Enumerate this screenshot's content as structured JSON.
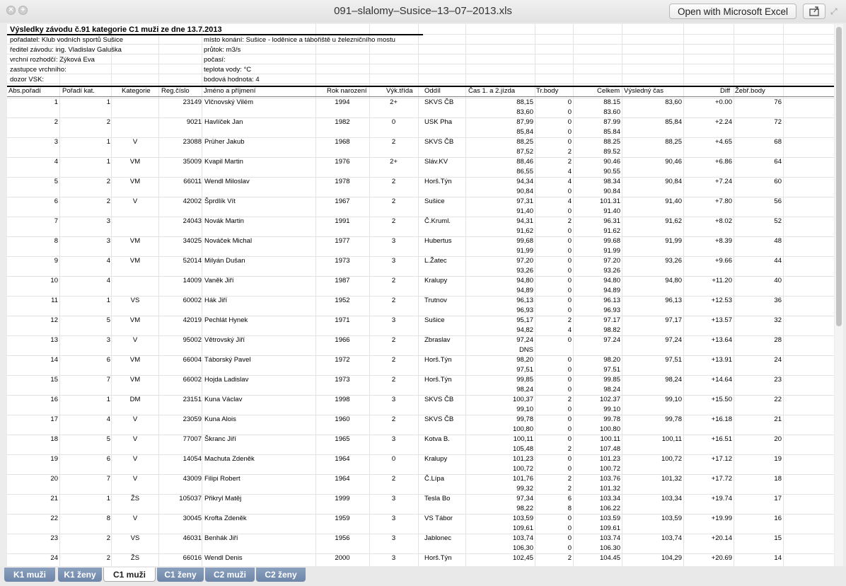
{
  "window": {
    "title": "091–slalomy–Susice–13–07–2013.xls",
    "open_button": "Open with Microsoft Excel",
    "close_icon": "close-icon",
    "zoom_icon": "zoom-plus-icon",
    "share_icon": "share-icon",
    "expand_icon": "expand-icon"
  },
  "info": {
    "title": "Výsledky závodu č.91 kategorie C1 muži ze dne 13.7.2013",
    "left": [
      "pořadatel: Klub vodních sportů Sušice",
      "ředitel závodu: ing. Vladislav Galuška",
      "vrchní rozhodčí: Zýková Eva",
      "zastupce vrchního:",
      "dozor VSK:"
    ],
    "right": [
      "místo konání: Sušice - loděnice a tábořiště u železničního mostu",
      "průtok:  m3/s",
      "počasí:",
      "teplota vody: °C",
      "bodová hodnota: 4"
    ]
  },
  "columns": [
    "Abs.pořadí",
    "Pořadí kat.",
    "Kategorie",
    "Reg.číslo",
    "Jméno a příjmení",
    "Rok narození",
    "Výk.třída",
    "Oddíl",
    "Čas 1. a 2.jízda",
    "Tr.body",
    "Celkem",
    "Výsledný čas",
    "Diff",
    "Žebř.body"
  ],
  "rows": [
    {
      "abs": "1",
      "kat": "1",
      "cat": "",
      "reg": "23149",
      "name": "Vlčnovský Vilém",
      "year": "1994",
      "cls": "2+",
      "club": "SKVS ČB",
      "t1": "88,15",
      "p1": "0",
      "c1": "88.15",
      "res": "83,60",
      "diff": "+0.00",
      "pts": "76",
      "t2": "83,60",
      "p2": "0",
      "c2": "83.60"
    },
    {
      "abs": "2",
      "kat": "2",
      "cat": "",
      "reg": "9021",
      "name": "Havlíček Jan",
      "year": "1982",
      "cls": "0",
      "club": "USK Pha",
      "t1": "87,99",
      "p1": "0",
      "c1": "87.99",
      "res": "85,84",
      "diff": "+2.24",
      "pts": "72",
      "t2": "85,84",
      "p2": "0",
      "c2": "85.84"
    },
    {
      "abs": "3",
      "kat": "1",
      "cat": "V",
      "reg": "23088",
      "name": "Prüher Jakub",
      "year": "1968",
      "cls": "2",
      "club": "SKVS ČB",
      "t1": "88,25",
      "p1": "0",
      "c1": "88.25",
      "res": "88,25",
      "diff": "+4.65",
      "pts": "68",
      "t2": "87,52",
      "p2": "2",
      "c2": "89.52"
    },
    {
      "abs": "4",
      "kat": "1",
      "cat": "VM",
      "reg": "35009",
      "name": "Kvapil Martin",
      "year": "1976",
      "cls": "2+",
      "club": "Sláv.KV",
      "t1": "88,46",
      "p1": "2",
      "c1": "90.46",
      "res": "90,46",
      "diff": "+6.86",
      "pts": "64",
      "t2": "86,55",
      "p2": "4",
      "c2": "90.55"
    },
    {
      "abs": "5",
      "kat": "2",
      "cat": "VM",
      "reg": "66011",
      "name": "Wendl Miloslav",
      "year": "1978",
      "cls": "2",
      "club": "Horš.Týn",
      "t1": "94,34",
      "p1": "4",
      "c1": "98.34",
      "res": "90,84",
      "diff": "+7.24",
      "pts": "60",
      "t2": "90,84",
      "p2": "0",
      "c2": "90.84"
    },
    {
      "abs": "6",
      "kat": "2",
      "cat": "V",
      "reg": "42002",
      "name": "Šprdlík Vít",
      "year": "1967",
      "cls": "2",
      "club": "Sušice",
      "t1": "97,31",
      "p1": "4",
      "c1": "101.31",
      "res": "91,40",
      "diff": "+7.80",
      "pts": "56",
      "t2": "91,40",
      "p2": "0",
      "c2": "91.40"
    },
    {
      "abs": "7",
      "kat": "3",
      "cat": "",
      "reg": "24043",
      "name": "Novák Martin",
      "year": "1991",
      "cls": "2",
      "club": "Č.Kruml.",
      "t1": "94,31",
      "p1": "2",
      "c1": "96.31",
      "res": "91,62",
      "diff": "+8.02",
      "pts": "52",
      "t2": "91,62",
      "p2": "0",
      "c2": "91.62"
    },
    {
      "abs": "8",
      "kat": "3",
      "cat": "VM",
      "reg": "34025",
      "name": "Nováček Michal",
      "year": "1977",
      "cls": "3",
      "club": "Hubertus",
      "t1": "99,68",
      "p1": "0",
      "c1": "99.68",
      "res": "91,99",
      "diff": "+8.39",
      "pts": "48",
      "t2": "91,99",
      "p2": "0",
      "c2": "91.99"
    },
    {
      "abs": "9",
      "kat": "4",
      "cat": "VM",
      "reg": "52014",
      "name": "Milyán Dušan",
      "year": "1973",
      "cls": "3",
      "club": "L.Žatec",
      "t1": "97,20",
      "p1": "0",
      "c1": "97.20",
      "res": "93,26",
      "diff": "+9.66",
      "pts": "44",
      "t2": "93,26",
      "p2": "0",
      "c2": "93.26"
    },
    {
      "abs": "10",
      "kat": "4",
      "cat": "",
      "reg": "14009",
      "name": "Vaněk Jiří",
      "year": "1987",
      "cls": "2",
      "club": "Kralupy",
      "t1": "94,80",
      "p1": "0",
      "c1": "94.80",
      "res": "94,80",
      "diff": "+11.20",
      "pts": "40",
      "t2": "94,89",
      "p2": "0",
      "c2": "94.89"
    },
    {
      "abs": "11",
      "kat": "1",
      "cat": "VS",
      "reg": "60002",
      "name": "Hák Jiří",
      "year": "1952",
      "cls": "2",
      "club": "Trutnov",
      "t1": "96,13",
      "p1": "0",
      "c1": "96.13",
      "res": "96,13",
      "diff": "+12.53",
      "pts": "36",
      "t2": "96,93",
      "p2": "0",
      "c2": "96.93"
    },
    {
      "abs": "12",
      "kat": "5",
      "cat": "VM",
      "reg": "42019",
      "name": "Pechlát Hynek",
      "year": "1971",
      "cls": "3",
      "club": "Sušice",
      "t1": "95,17",
      "p1": "2",
      "c1": "97.17",
      "res": "97,17",
      "diff": "+13.57",
      "pts": "32",
      "t2": "94,82",
      "p2": "4",
      "c2": "98.82"
    },
    {
      "abs": "13",
      "kat": "3",
      "cat": "V",
      "reg": "95002",
      "name": "Větrovský Jiří",
      "year": "1966",
      "cls": "2",
      "club": "Zbraslav",
      "t1": "97,24",
      "p1": "0",
      "c1": "97.24",
      "res": "97,24",
      "diff": "+13.64",
      "pts": "28",
      "t2": "DNS",
      "p2": "",
      "c2": ""
    },
    {
      "abs": "14",
      "kat": "6",
      "cat": "VM",
      "reg": "66004",
      "name": "Táborský Pavel",
      "year": "1972",
      "cls": "2",
      "club": "Horš.Týn",
      "t1": "98,20",
      "p1": "0",
      "c1": "98.20",
      "res": "97,51",
      "diff": "+13.91",
      "pts": "24",
      "t2": "97,51",
      "p2": "0",
      "c2": "97.51"
    },
    {
      "abs": "15",
      "kat": "7",
      "cat": "VM",
      "reg": "66002",
      "name": "Hojda Ladislav",
      "year": "1973",
      "cls": "2",
      "club": "Horš.Týn",
      "t1": "99,85",
      "p1": "0",
      "c1": "99.85",
      "res": "98,24",
      "diff": "+14.64",
      "pts": "23",
      "t2": "98,24",
      "p2": "0",
      "c2": "98.24"
    },
    {
      "abs": "16",
      "kat": "1",
      "cat": "DM",
      "reg": "23151",
      "name": "Kuna Václav",
      "year": "1998",
      "cls": "3",
      "club": "SKVS ČB",
      "t1": "100,37",
      "p1": "2",
      "c1": "102.37",
      "res": "99,10",
      "diff": "+15.50",
      "pts": "22",
      "t2": "99,10",
      "p2": "0",
      "c2": "99.10"
    },
    {
      "abs": "17",
      "kat": "4",
      "cat": "V",
      "reg": "23059",
      "name": "Kuna Alois",
      "year": "1960",
      "cls": "2",
      "club": "SKVS ČB",
      "t1": "99,78",
      "p1": "0",
      "c1": "99.78",
      "res": "99,78",
      "diff": "+16.18",
      "pts": "21",
      "t2": "100,80",
      "p2": "0",
      "c2": "100.80"
    },
    {
      "abs": "18",
      "kat": "5",
      "cat": "V",
      "reg": "77007",
      "name": "Škranc Jiří",
      "year": "1965",
      "cls": "3",
      "club": "Kotva B.",
      "t1": "100,11",
      "p1": "0",
      "c1": "100.11",
      "res": "100,11",
      "diff": "+16.51",
      "pts": "20",
      "t2": "105,48",
      "p2": "2",
      "c2": "107.48"
    },
    {
      "abs": "19",
      "kat": "6",
      "cat": "V",
      "reg": "14054",
      "name": "Machuta Zdeněk",
      "year": "1964",
      "cls": "0",
      "club": "Kralupy",
      "t1": "101,23",
      "p1": "0",
      "c1": "101.23",
      "res": "100,72",
      "diff": "+17.12",
      "pts": "19",
      "t2": "100,72",
      "p2": "0",
      "c2": "100.72"
    },
    {
      "abs": "20",
      "kat": "7",
      "cat": "V",
      "reg": "43009",
      "name": "Filipi Robert",
      "year": "1964",
      "cls": "2",
      "club": "Č.Lípa",
      "t1": "101,76",
      "p1": "2",
      "c1": "103.76",
      "res": "101,32",
      "diff": "+17.72",
      "pts": "18",
      "t2": "99,32",
      "p2": "2",
      "c2": "101.32"
    },
    {
      "abs": "21",
      "kat": "1",
      "cat": "ŽS",
      "reg": "105037",
      "name": "Přikryl Matěj",
      "year": "1999",
      "cls": "3",
      "club": "Tesla Bo",
      "t1": "97,34",
      "p1": "6",
      "c1": "103.34",
      "res": "103,34",
      "diff": "+19.74",
      "pts": "17",
      "t2": "98,22",
      "p2": "8",
      "c2": "106.22"
    },
    {
      "abs": "22",
      "kat": "8",
      "cat": "V",
      "reg": "30045",
      "name": "Krofta Zdeněk",
      "year": "1959",
      "cls": "3",
      "club": "VS Tábor",
      "t1": "103,59",
      "p1": "0",
      "c1": "103.59",
      "res": "103,59",
      "diff": "+19.99",
      "pts": "16",
      "t2": "109,61",
      "p2": "0",
      "c2": "109.61"
    },
    {
      "abs": "23",
      "kat": "2",
      "cat": "VS",
      "reg": "46031",
      "name": "Benhák Jiří",
      "year": "1956",
      "cls": "3",
      "club": "Jablonec",
      "t1": "103,74",
      "p1": "0",
      "c1": "103.74",
      "res": "103,74",
      "diff": "+20.14",
      "pts": "15",
      "t2": "106,30",
      "p2": "0",
      "c2": "106.30"
    },
    {
      "abs": "24",
      "kat": "2",
      "cat": "ŽS",
      "reg": "66016",
      "name": "Wendl Denis",
      "year": "2000",
      "cls": "3",
      "club": "Horš.Týn",
      "t1": "102,45",
      "p1": "2",
      "c1": "104.45",
      "res": "104,29",
      "diff": "+20.69",
      "pts": "14",
      "t2": "",
      "p2": "",
      "c2": ""
    }
  ],
  "tabs": [
    {
      "label": "K1 muži",
      "active": false
    },
    {
      "label": "K1 ženy",
      "active": false
    },
    {
      "label": "C1 muži",
      "active": true
    },
    {
      "label": "C1 ženy",
      "active": false
    },
    {
      "label": "C2 muži",
      "active": false
    },
    {
      "label": "C2 ženy",
      "active": false
    }
  ]
}
